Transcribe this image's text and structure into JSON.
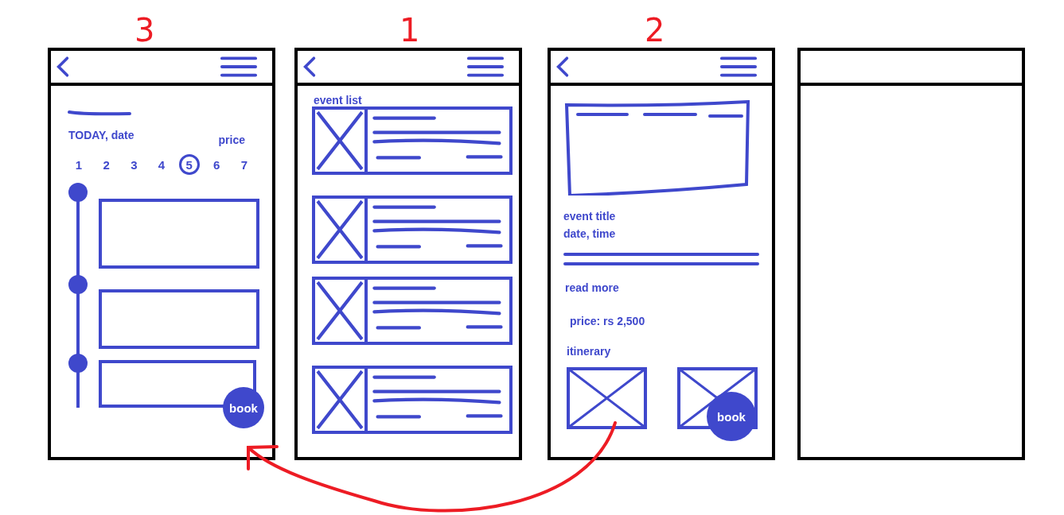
{
  "screens": [
    {
      "kind": "timeline",
      "number": "3",
      "today_label": "TODAY, date",
      "price_label": "price",
      "days": [
        {
          "label": "1",
          "selected": false
        },
        {
          "label": "2",
          "selected": false
        },
        {
          "label": "3",
          "selected": false
        },
        {
          "label": "4",
          "selected": false
        },
        {
          "label": "5",
          "selected": true
        },
        {
          "label": "6",
          "selected": false
        },
        {
          "label": "7",
          "selected": false
        }
      ],
      "book_label": "book"
    },
    {
      "kind": "list",
      "number": "1",
      "heading": "event list"
    },
    {
      "kind": "detail",
      "number": "2",
      "title": "event title",
      "datetime": "date, time",
      "read_more": "read more",
      "price": "price: rs 2,500",
      "itinerary": "itinerary",
      "book_label": "book"
    },
    {
      "kind": "blank"
    }
  ]
}
